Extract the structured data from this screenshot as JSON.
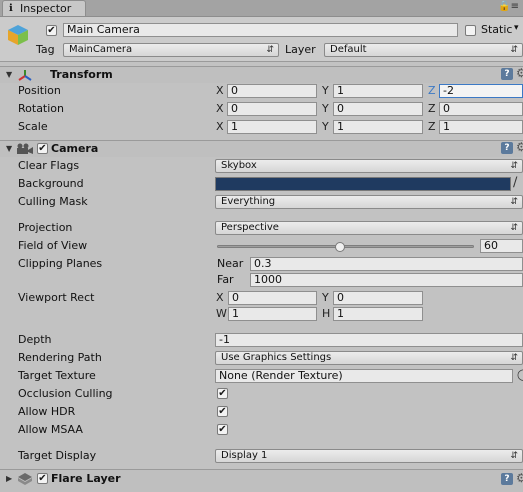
{
  "tab": {
    "label": "Inspector",
    "icon": "info-icon"
  },
  "header": {
    "object_name": "Main Camera",
    "static_label": "Static",
    "tag_label": "Tag",
    "tag_value": "MainCamera",
    "layer_label": "Layer",
    "layer_value": "Default",
    "active": true,
    "static": false
  },
  "transform": {
    "title": "Transform",
    "position_label": "Position",
    "rotation_label": "Rotation",
    "scale_label": "Scale",
    "axis_x": "X",
    "axis_y": "Y",
    "axis_z": "Z",
    "position": {
      "x": "0",
      "y": "1",
      "z": "-2"
    },
    "rotation": {
      "x": "0",
      "y": "0",
      "z": "0"
    },
    "scale": {
      "x": "1",
      "y": "1",
      "z": "1"
    }
  },
  "camera": {
    "title": "Camera",
    "enabled": true,
    "clear_flags_label": "Clear Flags",
    "clear_flags_value": "Skybox",
    "background_label": "Background",
    "background_color": "#1f3a60",
    "culling_mask_label": "Culling Mask",
    "culling_mask_value": "Everything",
    "projection_label": "Projection",
    "projection_value": "Perspective",
    "fov_label": "Field of View",
    "fov_value": "60",
    "fov_fraction": 0.48,
    "clipping_label": "Clipping Planes",
    "near_label": "Near",
    "near_value": "0.3",
    "far_label": "Far",
    "far_value": "1000",
    "viewport_label": "Viewport Rect",
    "vp_x_label": "X",
    "vp_y_label": "Y",
    "vp_w_label": "W",
    "vp_h_label": "H",
    "vp_x": "0",
    "vp_y": "0",
    "vp_w": "1",
    "vp_h": "1",
    "depth_label": "Depth",
    "depth_value": "-1",
    "rendering_path_label": "Rendering Path",
    "rendering_path_value": "Use Graphics Settings",
    "target_texture_label": "Target Texture",
    "target_texture_value": "None (Render Texture)",
    "occlusion_label": "Occlusion Culling",
    "hdr_label": "Allow HDR",
    "msaa_label": "Allow MSAA",
    "occlusion": true,
    "hdr": true,
    "msaa": true,
    "target_display_label": "Target Display",
    "target_display_value": "Display 1"
  },
  "flare": {
    "title": "Flare Layer",
    "enabled": true
  }
}
